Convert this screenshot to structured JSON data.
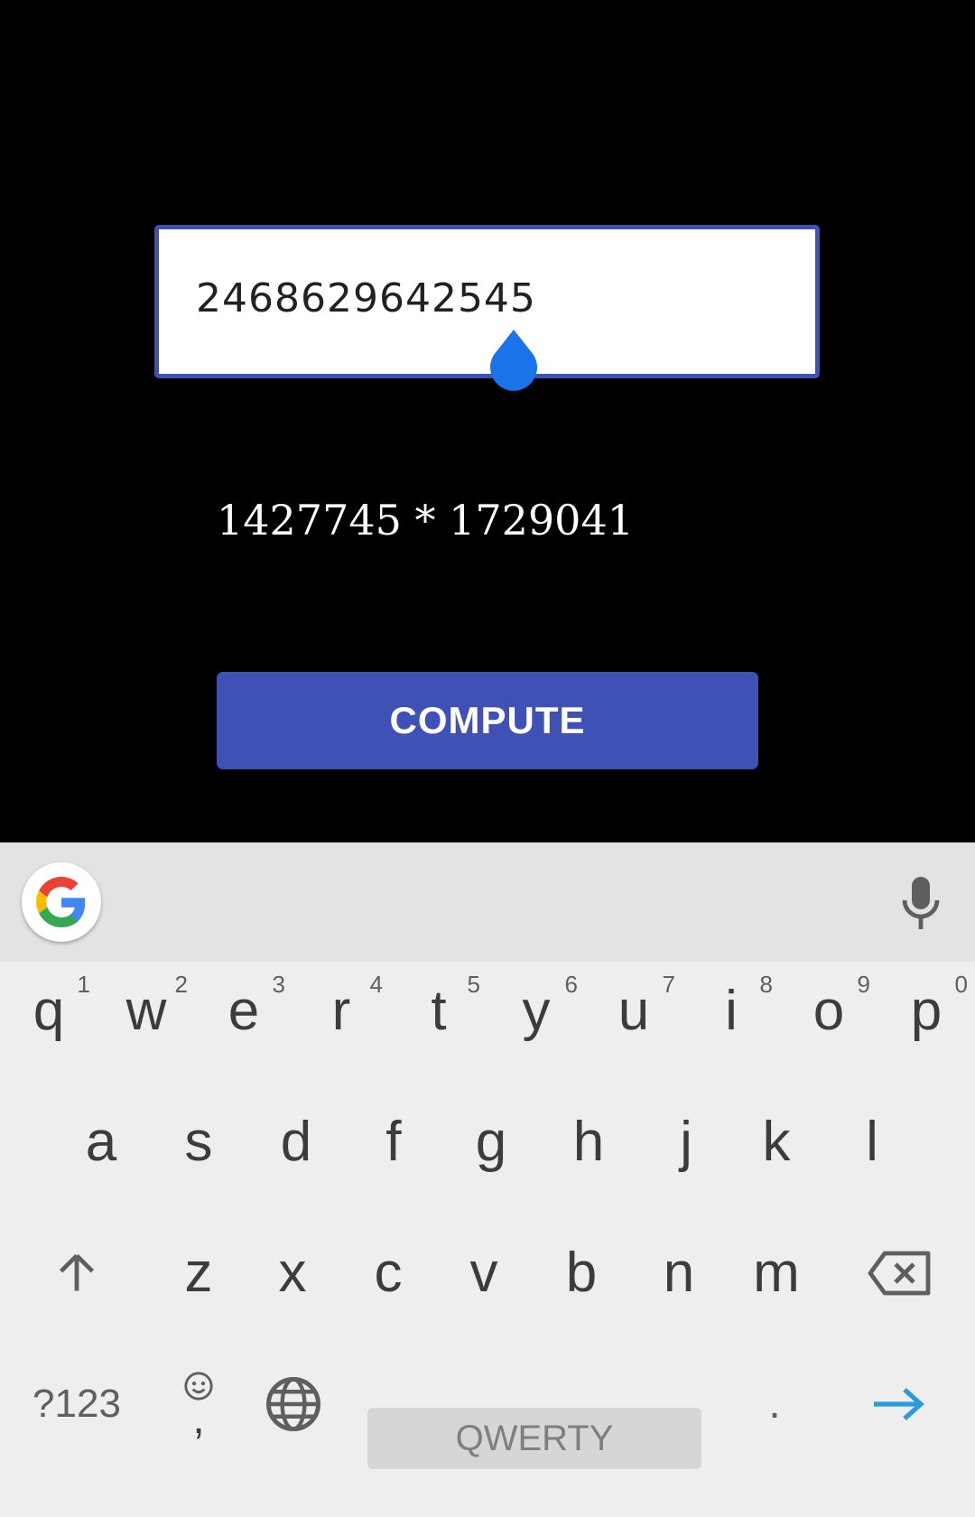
{
  "app": {
    "input_value": "2468629642545",
    "result_text": "1427745 * 1729041",
    "compute_label": "COMPUTE",
    "accent_color": "#3f51b5"
  },
  "keyboard": {
    "row1": [
      {
        "key": "q",
        "hint": "1"
      },
      {
        "key": "w",
        "hint": "2"
      },
      {
        "key": "e",
        "hint": "3"
      },
      {
        "key": "r",
        "hint": "4"
      },
      {
        "key": "t",
        "hint": "5"
      },
      {
        "key": "y",
        "hint": "6"
      },
      {
        "key": "u",
        "hint": "7"
      },
      {
        "key": "i",
        "hint": "8"
      },
      {
        "key": "o",
        "hint": "9"
      },
      {
        "key": "p",
        "hint": "0"
      }
    ],
    "row2": [
      "a",
      "s",
      "d",
      "f",
      "g",
      "h",
      "j",
      "k",
      "l"
    ],
    "row3": [
      "z",
      "x",
      "c",
      "v",
      "b",
      "n",
      "m"
    ],
    "symbols_label": "?123",
    "comma_label": ",",
    "space_label": "QWERTY",
    "period_label": ".",
    "icons": [
      "google-icon",
      "mic-icon",
      "shift-icon",
      "backspace-icon",
      "emoji-icon",
      "globe-icon",
      "arrow-right-icon"
    ]
  }
}
